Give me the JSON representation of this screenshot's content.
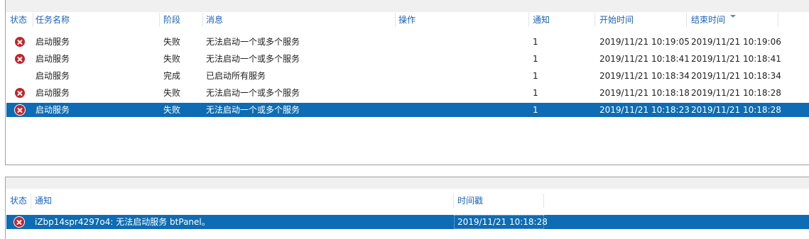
{
  "tasks_table": {
    "columns": {
      "status": "状态",
      "task_name": "任务名称",
      "stage": "阶段",
      "message": "消息",
      "action": "操作",
      "notify": "通知",
      "start_time": "开始时间",
      "end_time": "结束时间"
    },
    "sort": {
      "column": "end_time",
      "direction": "descending"
    },
    "rows": [
      {
        "status": "error",
        "task_name": "启动服务",
        "stage": "失败",
        "message": "无法启动一个或多个服务",
        "action": "",
        "notify": "1",
        "start_time": "2019/11/21 10:19:05",
        "end_time": "2019/11/21 10:19:06",
        "selected": false
      },
      {
        "status": "error",
        "task_name": "启动服务",
        "stage": "失败",
        "message": "无法启动一个或多个服务",
        "action": "",
        "notify": "1",
        "start_time": "2019/11/21 10:18:41",
        "end_time": "2019/11/21 10:18:41",
        "selected": false
      },
      {
        "status": "none",
        "task_name": "启动服务",
        "stage": "完成",
        "message": "已启动所有服务",
        "action": "",
        "notify": "1",
        "start_time": "2019/11/21 10:18:34",
        "end_time": "2019/11/21 10:18:34",
        "selected": false
      },
      {
        "status": "error",
        "task_name": "启动服务",
        "stage": "失败",
        "message": "无法启动一个或多个服务",
        "action": "",
        "notify": "1",
        "start_time": "2019/11/21 10:18:18",
        "end_time": "2019/11/21 10:18:28",
        "selected": false
      },
      {
        "status": "error",
        "task_name": "启动服务",
        "stage": "失败",
        "message": "无法启动一个或多个服务",
        "action": "",
        "notify": "1",
        "start_time": "2019/11/21 10:18:23",
        "end_time": "2019/11/21 10:18:28",
        "selected": true
      }
    ]
  },
  "notifications_table": {
    "columns": {
      "status": "状态",
      "notification": "通知",
      "timestamp": "时间戳"
    },
    "rows": [
      {
        "status": "error",
        "notification": "iZbp14spr4297o4: 无法启动服务 btPanel。",
        "timestamp": "2019/11/21 10:18:28",
        "selected": true
      }
    ]
  },
  "icons": {
    "error": "error-circle-x-icon"
  },
  "colors": {
    "selection": "#0d6cb3",
    "header_text": "#1c63b8",
    "error": "#c6232a"
  }
}
